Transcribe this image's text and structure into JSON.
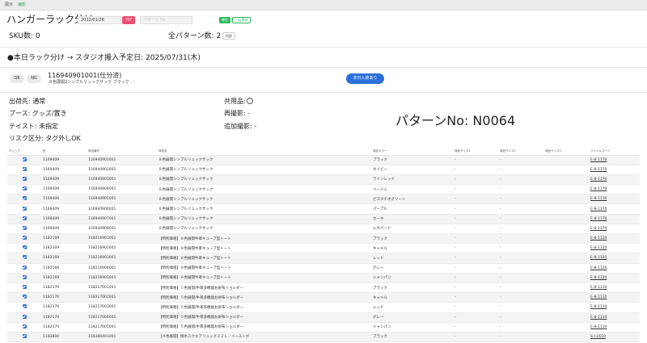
{
  "tabs": [
    {
      "label": "展示",
      "active": false
    },
    {
      "label": "撮影",
      "active": true
    }
  ],
  "header": {
    "title": "ハンガーラック分け",
    "date_value": "2022/01/28",
    "date_button_label": "ｸﾘｱ",
    "search_placeholder": "パターン No",
    "confirm_label": "確定",
    "bulk_label": "一括登録"
  },
  "summary": {
    "sku_count_text": "SKU数: 0",
    "pattern_count_text": "全パターン数: 2",
    "detail_button_label": "内訳"
  },
  "section": {
    "title": "●本日ラック分け → スタジオ搬入予定日: 2025/07/31(木)"
  },
  "product": {
    "ok_label": "OK",
    "ng_label": "NG",
    "code": "116940901001(仕分済)",
    "name": "８色展開2シンプルリュックサック ブラック - -",
    "today_button_label": "本日入荷あり"
  },
  "info": {
    "shipping": "出荷先: 通常",
    "booth": "ブース: グッズ/置き",
    "taste": "テイスト: 未指定",
    "risk": "リスク区分: タグ外しOK",
    "shared": "共用品:",
    "reshoot": "再撮影: -",
    "additional": "追加撮影: -",
    "pattern_no": "パターンNo: N0064"
  },
  "table": {
    "headers": [
      "チェック",
      "型",
      "商品番号",
      "商品名",
      "商品カラー",
      "商品サイズ1",
      "商品サイズ2",
      "商品サイズ3",
      "ジャンルコード"
    ],
    "rows": [
      {
        "checked": true,
        "style": "1169409",
        "item": "116940901001",
        "name": "８色展開シンプルリュックサック",
        "color": "ブラック",
        "s1": "-",
        "s2": "-",
        "s3": "",
        "code": "E-8-1170"
      },
      {
        "checked": true,
        "style": "1169409",
        "item": "116940902001",
        "name": "８色展開シンプルリュックサック",
        "color": "ネイビー",
        "s1": "-",
        "s2": "-",
        "s3": "",
        "code": "E-8-1170"
      },
      {
        "checked": true,
        "style": "1169409",
        "item": "116940903001",
        "name": "８色展開シンプルリュックサック",
        "color": "ワインレッド",
        "s1": "-",
        "s2": "-",
        "s3": "",
        "code": "E-8-1170"
      },
      {
        "checked": true,
        "style": "1169409",
        "item": "116940904001",
        "name": "８色展開シンプルリュックサック",
        "color": "ベージュ",
        "s1": "-",
        "s2": "-",
        "s3": "",
        "code": "E-8-1170"
      },
      {
        "checked": true,
        "style": "1169409",
        "item": "116940905001",
        "name": "８色展開シンプルリュックサック",
        "color": "ピスタチオグリーン",
        "s1": "-",
        "s2": "-",
        "s3": "",
        "code": "E-8-1170"
      },
      {
        "checked": true,
        "style": "1169409",
        "item": "116940906001",
        "name": "８色展開シンプルリュックサック",
        "color": "パープル",
        "s1": "-",
        "s2": "-",
        "s3": "",
        "code": "E-8-1170"
      },
      {
        "checked": true,
        "style": "1169409",
        "item": "116940907001",
        "name": "８色展開シンプルリュックサック",
        "color": "カーキ",
        "s1": "-",
        "s2": "-",
        "s3": "",
        "code": "E-8-1170"
      },
      {
        "checked": true,
        "style": "1169409",
        "item": "116940908001",
        "name": "８色展開シンプルリュックサック",
        "color": "レオパード",
        "s1": "-",
        "s2": "-",
        "s3": "",
        "code": "E-8-1170"
      },
      {
        "checked": true,
        "style": "1182169",
        "item": "118216901001",
        "name": "【特別価格】８色展開牛革キューブ型トート",
        "color": "ブラック",
        "s1": "-",
        "s2": "-",
        "s3": "",
        "code": "E-8-1120"
      },
      {
        "checked": true,
        "style": "1182169",
        "item": "118216902001",
        "name": "【特別価格】８色展開牛革キューブ型トート",
        "color": "キャメル",
        "s1": "-",
        "s2": "-",
        "s3": "",
        "code": "E-8-1120"
      },
      {
        "checked": true,
        "style": "1182169",
        "item": "118216903001",
        "name": "【特別価格】８色展開牛革キューブ型トート",
        "color": "レッド",
        "s1": "-",
        "s2": "-",
        "s3": "",
        "code": "E-8-1120"
      },
      {
        "checked": true,
        "style": "1182169",
        "item": "118216904001",
        "name": "【特別価格】８色展開牛革キューブ型トート",
        "color": "グレー",
        "s1": "-",
        "s2": "-",
        "s3": "",
        "code": "E-8-1120"
      },
      {
        "checked": true,
        "style": "1182169",
        "item": "118216905001",
        "name": "【特別価格】８色展開牛革キューブ型トート",
        "color": "シャンパン",
        "s1": "-",
        "s2": "-",
        "s3": "",
        "code": "E-8-1120"
      },
      {
        "checked": true,
        "style": "1182170",
        "item": "118217001001",
        "name": "【特別価格】５色展開/牛革多機能お財布ショルダー",
        "color": "ブラック",
        "s1": "-",
        "s2": "-",
        "s3": "",
        "code": "E-8-1110"
      },
      {
        "checked": true,
        "style": "1182170",
        "item": "118217002001",
        "name": "【特別価格】５色展開/牛革多機能お財布ショルダー",
        "color": "キャメル",
        "s1": "-",
        "s2": "-",
        "s3": "",
        "code": "E-8-1110"
      },
      {
        "checked": true,
        "style": "1182170",
        "item": "118217003001",
        "name": "【特別価格】５色展開/牛革多機能お財布ショルダー",
        "color": "レッド",
        "s1": "-",
        "s2": "-",
        "s3": "",
        "code": "E-8-1110"
      },
      {
        "checked": true,
        "style": "1182170",
        "item": "118217004001",
        "name": "【特別価格】５色展開/牛革多機能お財布ショルダー",
        "color": "グレー",
        "s1": "-",
        "s2": "-",
        "s3": "",
        "code": "E-8-1110"
      },
      {
        "checked": true,
        "style": "1182170",
        "item": "118217005001",
        "name": "【特別価格】５色展開/牛革多機能お財布ショルダー",
        "color": "シャンパン",
        "s1": "-",
        "s2": "-",
        "s3": "",
        "code": "E-8-1110"
      },
      {
        "checked": true,
        "style": "1183804",
        "item": "118380401001",
        "name": "【４色展開】撥水スクエアリュック２２Ｌ／イーストボ",
        "color": "ブラック",
        "s1": "-",
        "s2": "-",
        "s3": "",
        "code": "S-I-1610"
      }
    ]
  }
}
